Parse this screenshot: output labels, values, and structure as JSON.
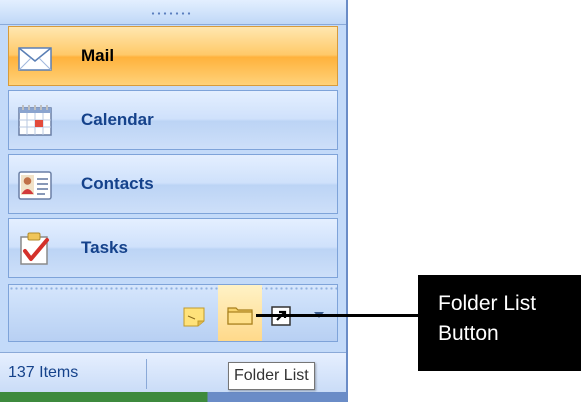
{
  "nav_pane": {
    "buttons": [
      {
        "label": "Mail",
        "icon": "mail-icon",
        "active": true
      },
      {
        "label": "Calendar",
        "icon": "calendar-icon",
        "active": false
      },
      {
        "label": "Contacts",
        "icon": "contacts-icon",
        "active": false
      },
      {
        "label": "Tasks",
        "icon": "tasks-icon",
        "active": false
      }
    ],
    "toolbar_icons": [
      "notes-icon",
      "folder-icon",
      "shortcut-icon",
      "chevron-down-icon"
    ]
  },
  "status_bar": {
    "item_count": "137 Items"
  },
  "tooltip": {
    "text": "Folder List"
  },
  "callout": {
    "line1": "Folder List",
    "line2": "Button"
  },
  "colors": {
    "active_button": "#ffc968",
    "pane_blue": "#c3daf9",
    "label_blue": "#15428b",
    "callout_bg": "#000000"
  }
}
